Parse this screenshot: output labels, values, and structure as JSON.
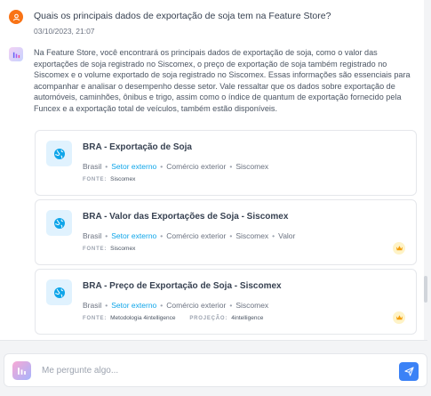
{
  "conversation": {
    "question": "Quais os principais dados de exportação de soja tem na Feature Store?",
    "timestamp": "03/10/2023, 21:07",
    "answer": "Na Feature Store, você encontrará os principais dados de exportação de soja, como o valor das exportações de soja registrado no Siscomex, o preço de exportação de soja também registrado no Siscomex e o volume exportado de soja registrado no Siscomex. Essas informações são essenciais para acompanhar e analisar o desempenho desse setor. Vale ressaltar que os dados sobre exportação de automóveis, caminhões, ônibus e trigo, assim como o índice de quantum de exportação fornecido pela Funcex e a exportação total de veículos, também estão disponíveis."
  },
  "cards": [
    {
      "title": "BRA - Exportação de Soja",
      "tags": [
        "Brasil",
        "Setor externo",
        "Comércio exterior",
        "Siscomex"
      ],
      "source_label": "FONTE:",
      "source": "Siscomex"
    },
    {
      "title": "BRA - Valor das Exportações de Soja - Siscomex",
      "tags": [
        "Brasil",
        "Setor externo",
        "Comércio exterior",
        "Siscomex",
        "Valor"
      ],
      "source_label": "FONTE:",
      "source": "Siscomex",
      "premium": true
    },
    {
      "title": "BRA - Preço de Exportação de Soja - Siscomex",
      "tags": [
        "Brasil",
        "Setor externo",
        "Comércio exterior",
        "Siscomex"
      ],
      "source_label": "FONTE:",
      "source": "Metodologia 4intelligence",
      "projection_label": "PROJEÇÃO:",
      "projection": "4intelligence",
      "premium": true
    }
  ],
  "input": {
    "placeholder": "Me pergunte algo..."
  },
  "icons": {
    "user_avatar": "user-icon",
    "bot_avatar": "chart-logo-icon",
    "card_icon": "globe-icon",
    "premium": "crown-icon",
    "send": "paper-plane-icon"
  },
  "colors": {
    "accent": "#0ea5e9",
    "send_button": "#3b82f6",
    "user_avatar": "#f97316",
    "premium": "#f59e0b"
  }
}
